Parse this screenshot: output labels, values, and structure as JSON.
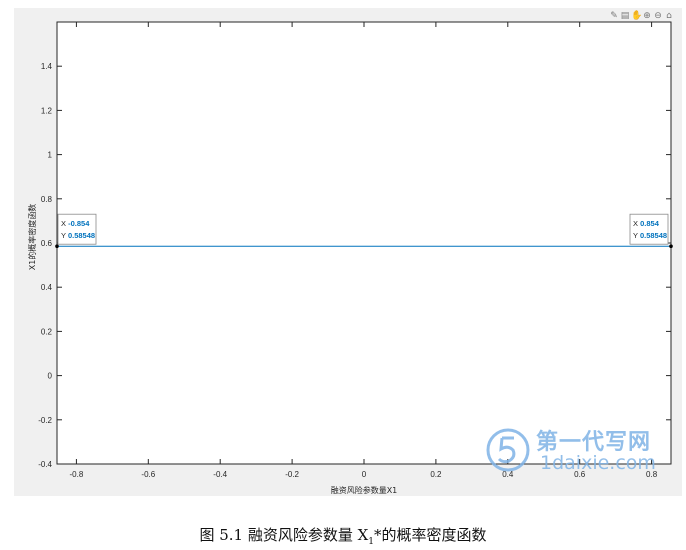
{
  "chart_data": {
    "type": "line",
    "title": "",
    "xlabel": "融资风险参数量X1",
    "ylabel": "X1的概率密度函数",
    "xlim": [
      -0.854,
      0.854
    ],
    "ylim": [
      -0.4,
      1.6
    ],
    "xticks": [
      -0.8,
      -0.6,
      -0.4,
      -0.2,
      0,
      0.2,
      0.4,
      0.6,
      0.8
    ],
    "xtick_labels": [
      "-0.8",
      "-0.6",
      "-0.4",
      "-0.2",
      "0",
      "0.2",
      "0.4",
      "0.6",
      "0.8"
    ],
    "yticks": [
      -0.4,
      -0.2,
      0,
      0.2,
      0.4,
      0.6,
      0.8,
      1,
      1.2,
      1.4
    ],
    "ytick_labels": [
      "-0.4",
      "-0.2",
      "0",
      "0.2",
      "0.4",
      "0.6",
      "0.8",
      "1",
      "1.2",
      "1.4"
    ],
    "grid": false,
    "legend": "none",
    "series": [
      {
        "x": [
          -0.854,
          0.854
        ],
        "y": [
          0.58548,
          0.58548
        ],
        "color": "#0072bd"
      }
    ],
    "annotations": [
      {
        "x": -0.854,
        "y": 0.58548,
        "x_text": "X",
        "x_value": "-0.854",
        "y_text": "Y",
        "y_value": "0.58548"
      },
      {
        "x": 0.854,
        "y": 0.58548,
        "x_text": "X",
        "x_value": "0.854",
        "y_text": "Y",
        "y_value": "0.58548"
      }
    ]
  },
  "toolbar": {
    "icons": [
      "brush-icon",
      "data-cursor-icon",
      "pan-icon",
      "zoom-in-icon",
      "zoom-out-icon",
      "home-icon"
    ]
  },
  "caption": {
    "prefix": "图 5.1 融资风险参数量 X",
    "subscript": "1",
    "suffix": "*的概率密度函数"
  },
  "watermark": {
    "title": "第一代写网",
    "url": "1daixie.com"
  },
  "colors": {
    "line": "#0072bd",
    "datatip_value": "#0072bd",
    "figure_bg": "#f0f0f0",
    "watermark": "#7fb3e6"
  }
}
